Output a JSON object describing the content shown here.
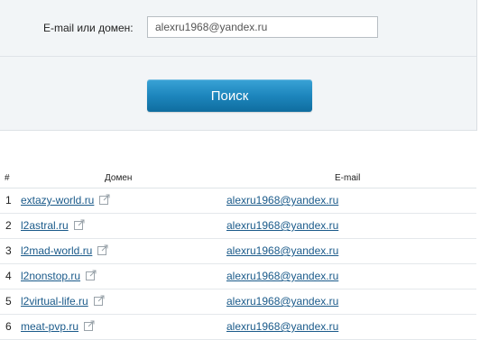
{
  "search": {
    "label": "E-mail или домен:",
    "value": "alexru1968@yandex.ru",
    "button_label": "Поиск"
  },
  "table": {
    "columns": [
      "#",
      "Домен",
      "E-mail"
    ],
    "rows": [
      {
        "num": "1",
        "domain": "extazy-world.ru",
        "email": "alexru1968@yandex.ru"
      },
      {
        "num": "2",
        "domain": "l2astral.ru",
        "email": "alexru1968@yandex.ru"
      },
      {
        "num": "3",
        "domain": "l2mad-world.ru",
        "email": "alexru1968@yandex.ru"
      },
      {
        "num": "4",
        "domain": "l2nonstop.ru",
        "email": "alexru1968@yandex.ru"
      },
      {
        "num": "5",
        "domain": "l2virtual-life.ru",
        "email": "alexru1968@yandex.ru"
      },
      {
        "num": "6",
        "domain": "meat-pvp.ru",
        "email": "alexru1968@yandex.ru"
      }
    ]
  },
  "icons": {
    "external_link": "external-link-icon"
  },
  "colors": {
    "button": "#1d86bd",
    "link": "#1a5a8a",
    "panel_bg": "#f2f5f7"
  }
}
